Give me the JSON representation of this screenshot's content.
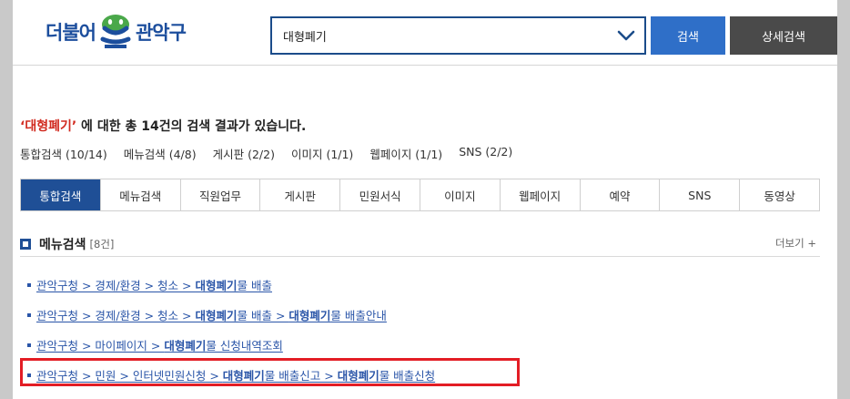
{
  "header": {
    "logo_text_left": "더불어",
    "logo_text_right": "관악구",
    "search_value": "대형폐기",
    "search_button": "검색",
    "detail_button": "상세검색"
  },
  "summary": {
    "quote_open": "‘",
    "keyword": "대형폐기",
    "quote_close": "’",
    "text_before_count": " 에 대한 총 ",
    "count": "14건",
    "text_after_count": "의 검색 결과가 있습니다."
  },
  "counts": [
    "통합검색 (10/14)",
    "메뉴검색 (4/8)",
    "게시판 (2/2)",
    "이미지 (1/1)",
    "웹페이지 (1/1)",
    "SNS (2/2)"
  ],
  "tabs": [
    "통합검색",
    "메뉴검색",
    "직원업무",
    "게시판",
    "민원서식",
    "이미지",
    "웹페이지",
    "예약",
    "SNS",
    "동영상"
  ],
  "section": {
    "title": "메뉴검색",
    "count": "[8건]",
    "more": "더보기 +"
  },
  "results": [
    [
      {
        "t": "관악구청 > 경제/환경 > 청소 > ",
        "b": false
      },
      {
        "t": "대형폐기",
        "b": true
      },
      {
        "t": "물 배출",
        "b": false
      }
    ],
    [
      {
        "t": "관악구청 > 경제/환경 > 청소 > ",
        "b": false
      },
      {
        "t": "대형폐기",
        "b": true
      },
      {
        "t": "물 배출 > ",
        "b": false
      },
      {
        "t": "대형폐기",
        "b": true
      },
      {
        "t": "물 배출안내",
        "b": false
      }
    ],
    [
      {
        "t": "관악구청 > 마이페이지 > ",
        "b": false
      },
      {
        "t": "대형폐기",
        "b": true
      },
      {
        "t": "물 신청내역조회",
        "b": false
      }
    ],
    [
      {
        "t": "관악구청 > 민원 > 인터넷민원신청 > ",
        "b": false
      },
      {
        "t": "대형폐기",
        "b": true
      },
      {
        "t": "물 배출신고 > ",
        "b": false
      },
      {
        "t": "대형폐기",
        "b": true
      },
      {
        "t": "물 배출신청",
        "b": false
      }
    ]
  ],
  "colors": {
    "primary": "#1f4f96",
    "search_button": "#2f6fc8",
    "keyword": "#d12a1f",
    "link": "#2a55a8",
    "highlight": "#e31d25"
  }
}
